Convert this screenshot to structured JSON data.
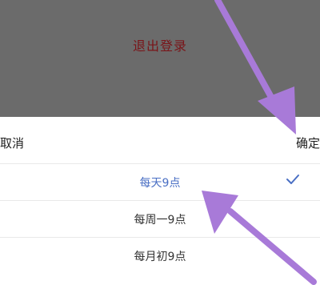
{
  "overlay": {
    "logout_label": "退出登录"
  },
  "picker": {
    "cancel_label": "取消",
    "confirm_label": "确定",
    "options": [
      {
        "label": "每天9点",
        "selected": true
      },
      {
        "label": "每周一9点",
        "selected": false
      },
      {
        "label": "每月初9点",
        "selected": false
      }
    ]
  },
  "colors": {
    "selected_text": "#4a6fc4",
    "logout_text": "#7a1418",
    "annotation_arrow": "#a87ad8"
  },
  "icons": {
    "selected_mark": "checkmark-icon"
  }
}
